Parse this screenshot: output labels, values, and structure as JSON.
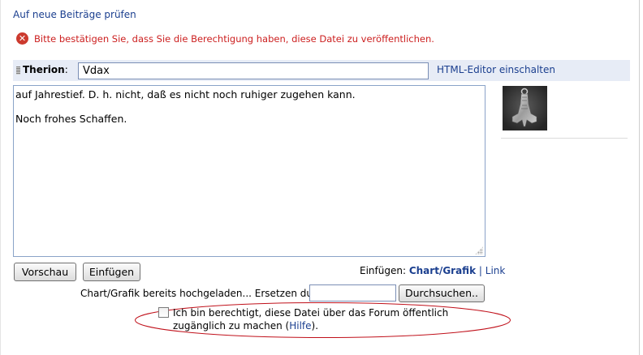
{
  "top_link": "Auf neue Beiträge prüfen",
  "error": {
    "icon": "error-circle-icon",
    "glyph": "✕",
    "message": "Bitte bestätigen Sie, dass Sie die Berechtigung haben, diese Datei zu veröffentlichen."
  },
  "header": {
    "user_name": "Therion",
    "user_suffix": ":",
    "title_value": "Vdax",
    "html_editor_link": "HTML-Editor einschalten"
  },
  "editor": {
    "content": "auf Jahrestief. D. h. nicht, daß es nicht noch ruhiger zugehen kann.\n\nNoch frohes Schaffen."
  },
  "buttons": {
    "preview": "Vorschau",
    "insert": "Einfügen"
  },
  "insert_links": {
    "prefix": "Einfügen:",
    "chart": "Chart/Grafik",
    "separator": "|",
    "link": "Link"
  },
  "upload": {
    "label": "Chart/Grafik bereits hochgeladen... Ersetzen durch:",
    "file_value": "",
    "browse_button": "Durchsuchen.."
  },
  "consent": {
    "checked": false,
    "text_before": "Ich bin berechtigt, diese Datei über das Forum öffentlich zugänglich zu machen (",
    "help_link": "Hilfe",
    "text_after": ")."
  },
  "colors": {
    "link": "#1b3f8f",
    "error": "#cc1f1f",
    "header_bg": "#e7ecf6",
    "highlight_ellipse": "#c0101a"
  }
}
